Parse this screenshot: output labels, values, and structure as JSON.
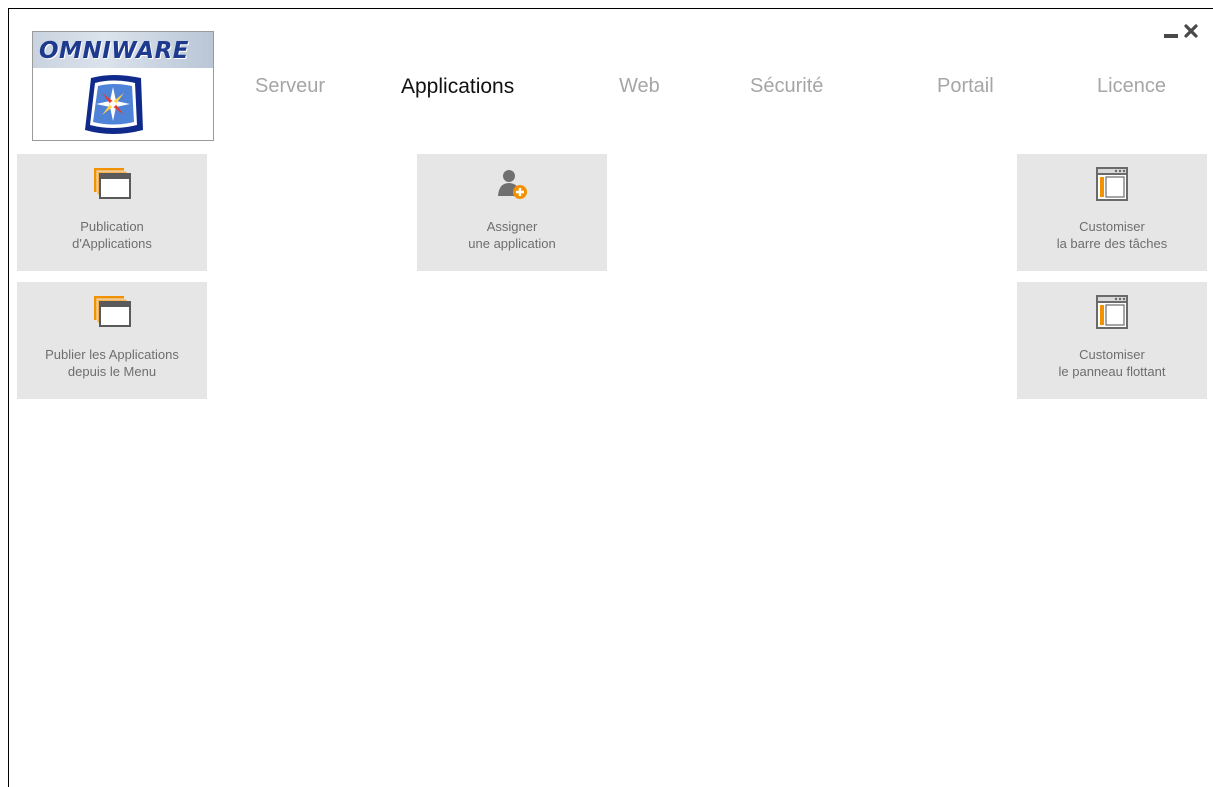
{
  "app": {
    "logo_text": "OMNIWARE",
    "controls": {
      "minimize_icon": "minimize-icon",
      "close_icon": "close-icon"
    }
  },
  "nav": {
    "tabs": [
      {
        "label": "Serveur",
        "active": false
      },
      {
        "label": "Applications",
        "active": true
      },
      {
        "label": "Web",
        "active": false
      },
      {
        "label": "Sécurité",
        "active": false
      },
      {
        "label": "Portail",
        "active": false
      },
      {
        "label": "Licence",
        "active": false
      }
    ]
  },
  "tiles": [
    {
      "icon": "app-windows-icon",
      "line1": "Publication",
      "line2": "d'Applications"
    },
    {
      "icon": "app-windows-icon",
      "line1": "Publier les Applications",
      "line2": "depuis le Menu"
    },
    {
      "icon": "add-user-icon",
      "line1": "Assigner",
      "line2": "une application"
    },
    {
      "icon": "taskbar-window-icon",
      "line1": "Customiser",
      "line2": "la barre des tâches"
    },
    {
      "icon": "taskbar-window-icon",
      "line1": "Customiser",
      "line2": "le panneau flottant"
    }
  ],
  "colors": {
    "accent": "#f39200",
    "tile_bg": "#e6e6e6",
    "tab_inactive": "#a6a6a6",
    "tab_active": "#111111",
    "logo_blue": "#1d3a8f"
  }
}
